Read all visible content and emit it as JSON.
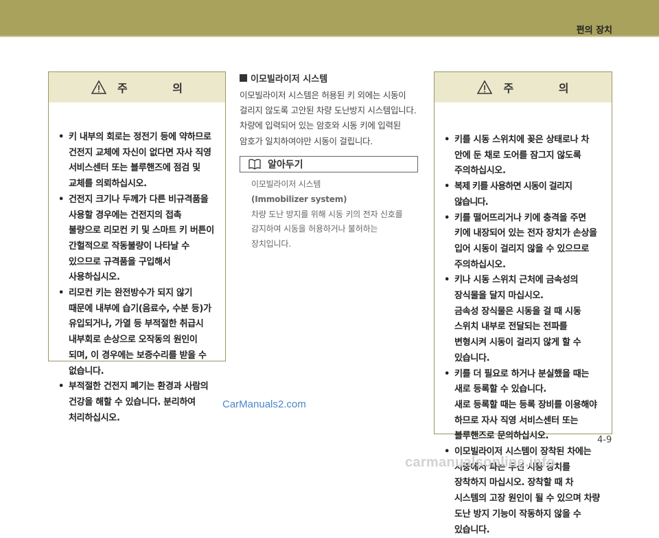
{
  "header": {
    "section_title": "편의 장치"
  },
  "caution_left": {
    "title": "주  의",
    "items": [
      "키 내부의 회로는 정전기 등에 약하므로 건전지 교체에 자신이 없다면 자사 직영 서비스센터 또는 블루핸즈에 점검 및 교체를 의뢰하십시오.",
      "건전지 크기나 두께가 다른 비규격품을 사용할 경우에는 건전지의 접촉 불량으로 리모컨 키 및 스마트 키 버튼이 간헐적으로 작동불량이 나타날 수 있으므로 규격품을 구입해서 사용하십시오.",
      "리모컨 키는 완전방수가 되지 않기 때문에 내부에 습기(음료수, 수분 등)가 유입되거나, 가열 등 부적절한 취급시 내부회로 손상으로 오작동의 원인이 되며, 이 경우에는 보증수리를 받을 수 없습니다.",
      "부적절한 건전지 폐기는 환경과 사람의 건강을 해할 수 있습니다. 분리하여 처리하십시오."
    ]
  },
  "immobilizer": {
    "heading": "이모빌라이저 시스템",
    "body": "이모빌라이저 시스템은 허용된 키 외에는 시동이 걸리지 않도록 고안된 차량 도난방지 시스템입니다. 차량에 입력되어 있는 암호와 시동 키에 입력된 암호가 일치하여야만 시동이 걸립니다."
  },
  "note": {
    "label": "알아두기",
    "term": "이모빌라이저 시스템",
    "term_en": "(Immobilizer system)",
    "description": "차량 도난 방지를 위해 시동 키의 전자 신호를 감지하여 시동을 허용하거나 불허하는 장치입니다."
  },
  "caution_right": {
    "title": "주  의",
    "items": [
      {
        "text": "키를 시동 스위치에 꽂은 상태로나 차 안에 둔 채로 도어를 잠그지 않도록 주의하십시오.",
        "extra": []
      },
      {
        "text": "복제 키를 사용하면 시동이 걸리지 않습니다.",
        "extra": []
      },
      {
        "text": "키를 떨어뜨리거나 키에 충격을 주면 키에 내장되어 있는 전자 장치가 손상을 입어 시동이 걸리지 않을 수 있으므로 주의하십시오.",
        "extra": []
      },
      {
        "text": "키나 시동 스위치 근처에 금속성의 장식물을 달지 마십시오.",
        "extra": [
          "금속성 장식물은 시동을 걸 때 시동 스위치 내부로 전달되는 전파를 변형시켜 시동이 걸리지 않게 할 수 있습니다."
        ]
      },
      {
        "text": "키를 더 필요로 하거나 분실했을 때는 새로 등록할 수 있습니다.",
        "extra": [
          "새로 등록할 때는 등록 장비를 이용해야 하므로 자사 직영 서비스센터 또는 블루핸즈로 문의하십시오."
        ]
      },
      {
        "text": "이모빌라이저 시스템이 장착된 차에는 시중에서 파는 무선 시동 장치를 장착하지 마십시오.  장착할 때 차 시스템의 고장 원인이 될 수 있으며 차량 도난 방지 기능이 작동하지 않을 수 있습니다.",
        "extra": []
      }
    ]
  },
  "footer": {
    "page_number": "4-9",
    "watermark_top": "CarManuals2.com",
    "watermark_bottom": "carmanualsonline.info"
  },
  "icons": {
    "warning": "warning-triangle-icon",
    "note": "book-icon",
    "bullet": "•"
  }
}
